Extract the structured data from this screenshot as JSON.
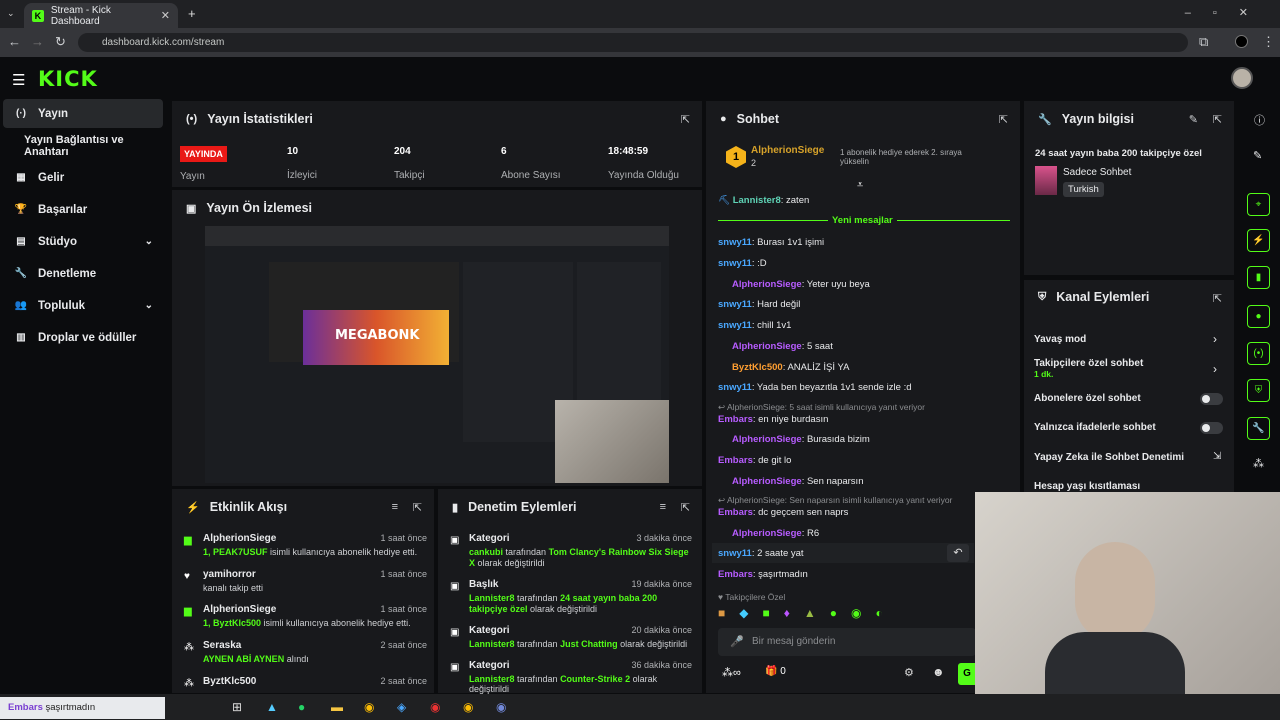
{
  "browser": {
    "tab_title": "Stream - Kick Dashboard",
    "url": "dashboard.kick.com/stream",
    "tab_close": "✕",
    "new_tab": "+"
  },
  "brand": {
    "logo": "KICK"
  },
  "sidebar": {
    "items": [
      {
        "label": "Yayın",
        "icon": "(·)"
      },
      {
        "label": "Yayın Bağlantısı ve Anahtarı",
        "icon": ""
      },
      {
        "label": "Gelir",
        "icon": "▦"
      },
      {
        "label": "Başarılar",
        "icon": "🏆"
      },
      {
        "label": "Stüdyo",
        "icon": "▤"
      },
      {
        "label": "Denetleme",
        "icon": "🔧"
      },
      {
        "label": "Topluluk",
        "icon": "👥"
      },
      {
        "label": "Droplar ve ödüller",
        "icon": "▥"
      }
    ]
  },
  "stats": {
    "title": "Yayın İstatistikleri",
    "live_badge": "YAYINDA",
    "live_label": "Yayın",
    "items": [
      {
        "value": "10",
        "label": "İzleyici"
      },
      {
        "value": "204",
        "label": "Takipçi"
      },
      {
        "value": "6",
        "label": "Abone Sayısı"
      },
      {
        "value": "18:48:59",
        "label": "Yayında Olduğu Süre"
      }
    ]
  },
  "preview": {
    "title": "Yayın Ön İzlemesi",
    "game_label": "MEGABONK"
  },
  "feed": {
    "title": "Etkinlik Akışı",
    "items": [
      {
        "name": "AlpherionSiege",
        "time": "1 saat önce",
        "hl": "1, PEAK7USUF",
        "rest": " isimli kullanıcıya abonelik hediye etti."
      },
      {
        "name": "yamihorror",
        "time": "1 saat önce",
        "hl": "",
        "rest": "kanalı takip etti"
      },
      {
        "name": "AlpherionSiege",
        "time": "1 saat önce",
        "hl": "1, ByztKlc500",
        "rest": " isimli kullanıcıya abonelik hediye etti."
      },
      {
        "name": "Seraska",
        "time": "2 saat önce",
        "hl": "AYNEN ABİ AYNEN",
        "rest": " alındı"
      },
      {
        "name": "ByztKlc500",
        "time": "2 saat önce",
        "hl": "",
        "rest": ""
      }
    ]
  },
  "moderation": {
    "title": "Denetim Eylemleri",
    "items": [
      {
        "kind": "Kategori",
        "time": "3 dakika önce",
        "user": "cankubi",
        "mid": " tarafından ",
        "target": "Tom Clancy's Rainbow Six Siege X",
        "end": " olarak değiştirildi"
      },
      {
        "kind": "Başlık",
        "time": "19 dakika önce",
        "user": "Lannister8",
        "mid": " tarafından ",
        "target": "24 saat yayın baba 200 takipçiye özel",
        "end": " olarak değiştirildi"
      },
      {
        "kind": "Kategori",
        "time": "20 dakika önce",
        "user": "Lannister8",
        "mid": " tarafından ",
        "target": "Just Chatting",
        "end": " olarak değiştirildi"
      },
      {
        "kind": "Kategori",
        "time": "36 dakika önce",
        "user": "Lannister8",
        "mid": " tarafından ",
        "target": "Counter-Strike 2",
        "end": " olarak değiştirildi"
      }
    ]
  },
  "chat": {
    "title": "Sohbet",
    "pinned": {
      "user": "AlpherionSiege",
      "count": "2",
      "text": "1 abonelik hediye ederek 2. sıraya yükselin"
    },
    "new_messages": "Yeni mesajlar",
    "messages": [
      {
        "user": "Lannister8",
        "text": ": zaten",
        "color": "green"
      },
      {
        "user": "snwy11",
        "text": ": Burası 1v1 işimi",
        "color": "blue"
      },
      {
        "user": "snwy11",
        "text": ": :D",
        "color": "blue"
      },
      {
        "user": "AlpherionSiege",
        "text": ": Yeter uyu beya",
        "color": "purple"
      },
      {
        "user": "snwy11",
        "text": ": Hard değil",
        "color": "blue"
      },
      {
        "user": "snwy11",
        "text": ": chill 1v1",
        "color": "blue"
      },
      {
        "user": "AlpherionSiege",
        "text": ": 5 saat",
        "color": "purple"
      },
      {
        "user": "ByztKlc500",
        "text": ": ANALİZ İŞİ YA",
        "color": "orange"
      },
      {
        "user": "snwy11",
        "text": ": Yada ben beyazıtla 1v1 sende izle :d",
        "color": "blue"
      },
      {
        "user": "Embars",
        "text": ": en niye burdasın",
        "color": "purple"
      },
      {
        "user": "AlpherionSiege",
        "text": ": Burasıda bizim",
        "color": "purple"
      },
      {
        "user": "Embars",
        "text": ": de git lo",
        "color": "purple"
      },
      {
        "user": "AlpherionSiege",
        "text": ": Sen naparsın",
        "color": "purple"
      },
      {
        "user": "Embars",
        "text": ": dc geçcem sen naprs",
        "color": "purple"
      },
      {
        "user": "AlpherionSiege",
        "text": ": R6",
        "color": "purple"
      },
      {
        "user": "snwy11",
        "text": ": 2 saate yat",
        "color": "blue"
      },
      {
        "user": "Embars",
        "text": ": şaşırtmadın",
        "color": "purple"
      }
    ],
    "reply1": "AlpherionSiege: 5 saat isimli kullanıcıya yanıt veriyor",
    "reply2": "AlpherionSiege: Sen naparsın isimli kullanıcıya yanıt veriyor",
    "followers_only": "Takipçilere Özel",
    "placeholder": "Bir mesaj gönderin",
    "points": "0",
    "send_label": "G"
  },
  "info": {
    "title": "Yayın bilgisi",
    "stream_title": "24 saat yayın baba 200 takipçiye özel",
    "category": "Sadece Sohbet",
    "language": "Turkish"
  },
  "channel_actions": {
    "title": "Kanal Eylemleri",
    "items": [
      {
        "label": "Yavaş mod",
        "sub": ""
      },
      {
        "label": "Takipçilere özel sohbet",
        "sub": "1 dk."
      },
      {
        "label": "Abonelere özel sohbet",
        "sub": ""
      },
      {
        "label": "Yalnızca ifadelerle sohbet",
        "sub": ""
      },
      {
        "label": "Yapay Zeka ile Sohbet Denetimi",
        "sub": ""
      },
      {
        "label": "Hesap yaşı kısıtlaması",
        "sub": ""
      }
    ]
  },
  "taskbar": {
    "notification": "şaşırtmadın",
    "notification_user": "Embars"
  },
  "colors": {
    "accent": "#53fc18",
    "live": "#e91916",
    "panel": "#18191c"
  }
}
